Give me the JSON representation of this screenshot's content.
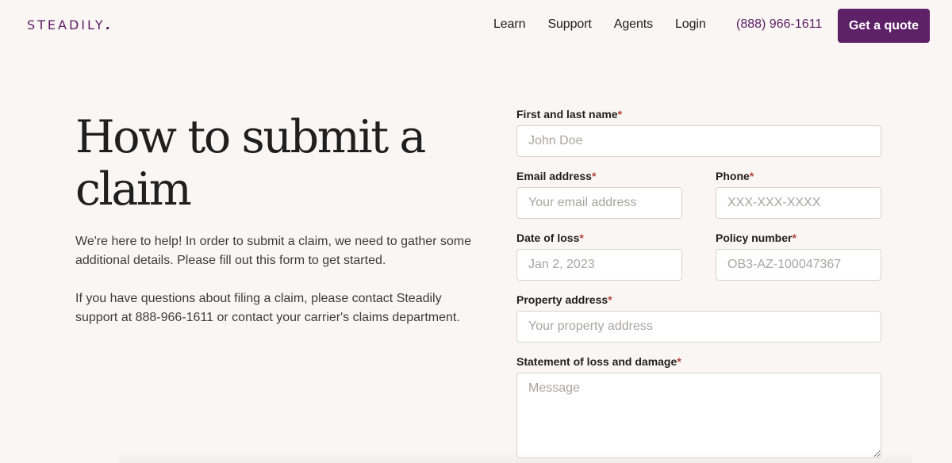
{
  "brand": {
    "logo_text": "STEADILY",
    "logo_dot": ".",
    "accent_color": "#5e2168",
    "required_color": "#b5473c"
  },
  "nav": {
    "items": [
      {
        "label": "Learn"
      },
      {
        "label": "Support"
      },
      {
        "label": "Agents"
      },
      {
        "label": "Login"
      }
    ],
    "phone": "(888) 966-1611",
    "cta_label": "Get a quote"
  },
  "hero": {
    "title": "How to submit a claim",
    "paragraphs": [
      "We're here to help! In order to submit a claim, we need to gather some additional details. Please fill out this form to get started.",
      "If you have questions about filing a claim, please contact Steadily support at 888-966-1611 or contact your carrier's claims department."
    ]
  },
  "form": {
    "required_marker": "*",
    "fields": {
      "name": {
        "label": "First and last name",
        "placeholder": "John Doe",
        "value": ""
      },
      "email": {
        "label": "Email address",
        "placeholder": "Your email address",
        "value": ""
      },
      "phone": {
        "label": "Phone",
        "placeholder": "XXX-XXX-XXXX",
        "value": ""
      },
      "date": {
        "label": "Date of loss",
        "placeholder": "Jan 2, 2023",
        "value": ""
      },
      "policy": {
        "label": "Policy number",
        "placeholder": "OB3-AZ-100047367",
        "value": ""
      },
      "address": {
        "label": "Property address",
        "placeholder": "Your property address",
        "value": ""
      },
      "statement": {
        "label": "Statement of loss and damage",
        "placeholder": "Message",
        "value": ""
      }
    }
  }
}
